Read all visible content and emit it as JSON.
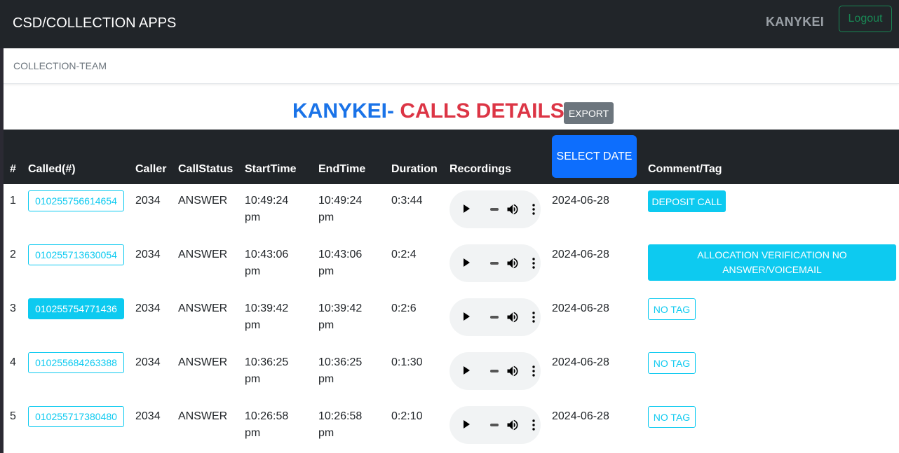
{
  "navbar": {
    "brand": "CSD/COLLECTION APPS",
    "user": "KANYKEI",
    "logout_label": "Logout"
  },
  "subbar": {
    "label": "COLLECTION-TEAM"
  },
  "heading": {
    "name": "KANYKEI-",
    "title": " CALLS DETAILS",
    "export_label": "EXPORT"
  },
  "table": {
    "headers": {
      "num": "#",
      "called": "Called(#)",
      "caller": "Caller",
      "status": "CallStatus",
      "start": "StartTime",
      "end": "EndTime",
      "duration": "Duration",
      "recordings": "Recordings",
      "select_date": "SELECT DATE",
      "comment": "Comment/Tag"
    },
    "rows": [
      {
        "num": "1",
        "called": "010255756614654",
        "caller": "2034",
        "status": "ANSWER",
        "start_time": "10:49:24",
        "start_ampm": "pm",
        "end_time": "10:49:24",
        "end_ampm": "pm",
        "duration": "0:3:44",
        "date": "2024-06-28",
        "tag": "DEPOSIT CALL"
      },
      {
        "num": "2",
        "called": "010255713630054",
        "caller": "2034",
        "status": "ANSWER",
        "start_time": "10:43:06",
        "start_ampm": "pm",
        "end_time": "10:43:06",
        "end_ampm": "pm",
        "duration": "0:2:4",
        "date": "2024-06-28",
        "tag": "ALLOCATION VERIFICATION NO ANSWER/VOICEMAIL"
      },
      {
        "num": "3",
        "called": "010255754771436",
        "caller": "2034",
        "status": "ANSWER",
        "start_time": "10:39:42",
        "start_ampm": "pm",
        "end_time": "10:39:42",
        "end_ampm": "pm",
        "duration": "0:2:6",
        "date": "2024-06-28",
        "tag": "NO TAG"
      },
      {
        "num": "4",
        "called": "010255684263388",
        "caller": "2034",
        "status": "ANSWER",
        "start_time": "10:36:25",
        "start_ampm": "pm",
        "end_time": "10:36:25",
        "end_ampm": "pm",
        "duration": "0:1:30",
        "date": "2024-06-28",
        "tag": "NO TAG"
      },
      {
        "num": "5",
        "called": "010255717380480",
        "caller": "2034",
        "status": "ANSWER",
        "start_time": "10:26:58",
        "start_ampm": "pm",
        "end_time": "10:26:58",
        "end_ampm": "pm",
        "duration": "0:2:10",
        "date": "2024-06-28",
        "tag": "NO TAG"
      }
    ]
  },
  "icons": {
    "play": "play-icon",
    "volume": "volume-icon",
    "more": "more-vert-icon"
  },
  "colors": {
    "navbar": "#212529",
    "info": "#0dcaf0",
    "primary": "#0d6efd",
    "danger": "#dc3545",
    "success": "#198754",
    "secondary": "#6c757d"
  }
}
